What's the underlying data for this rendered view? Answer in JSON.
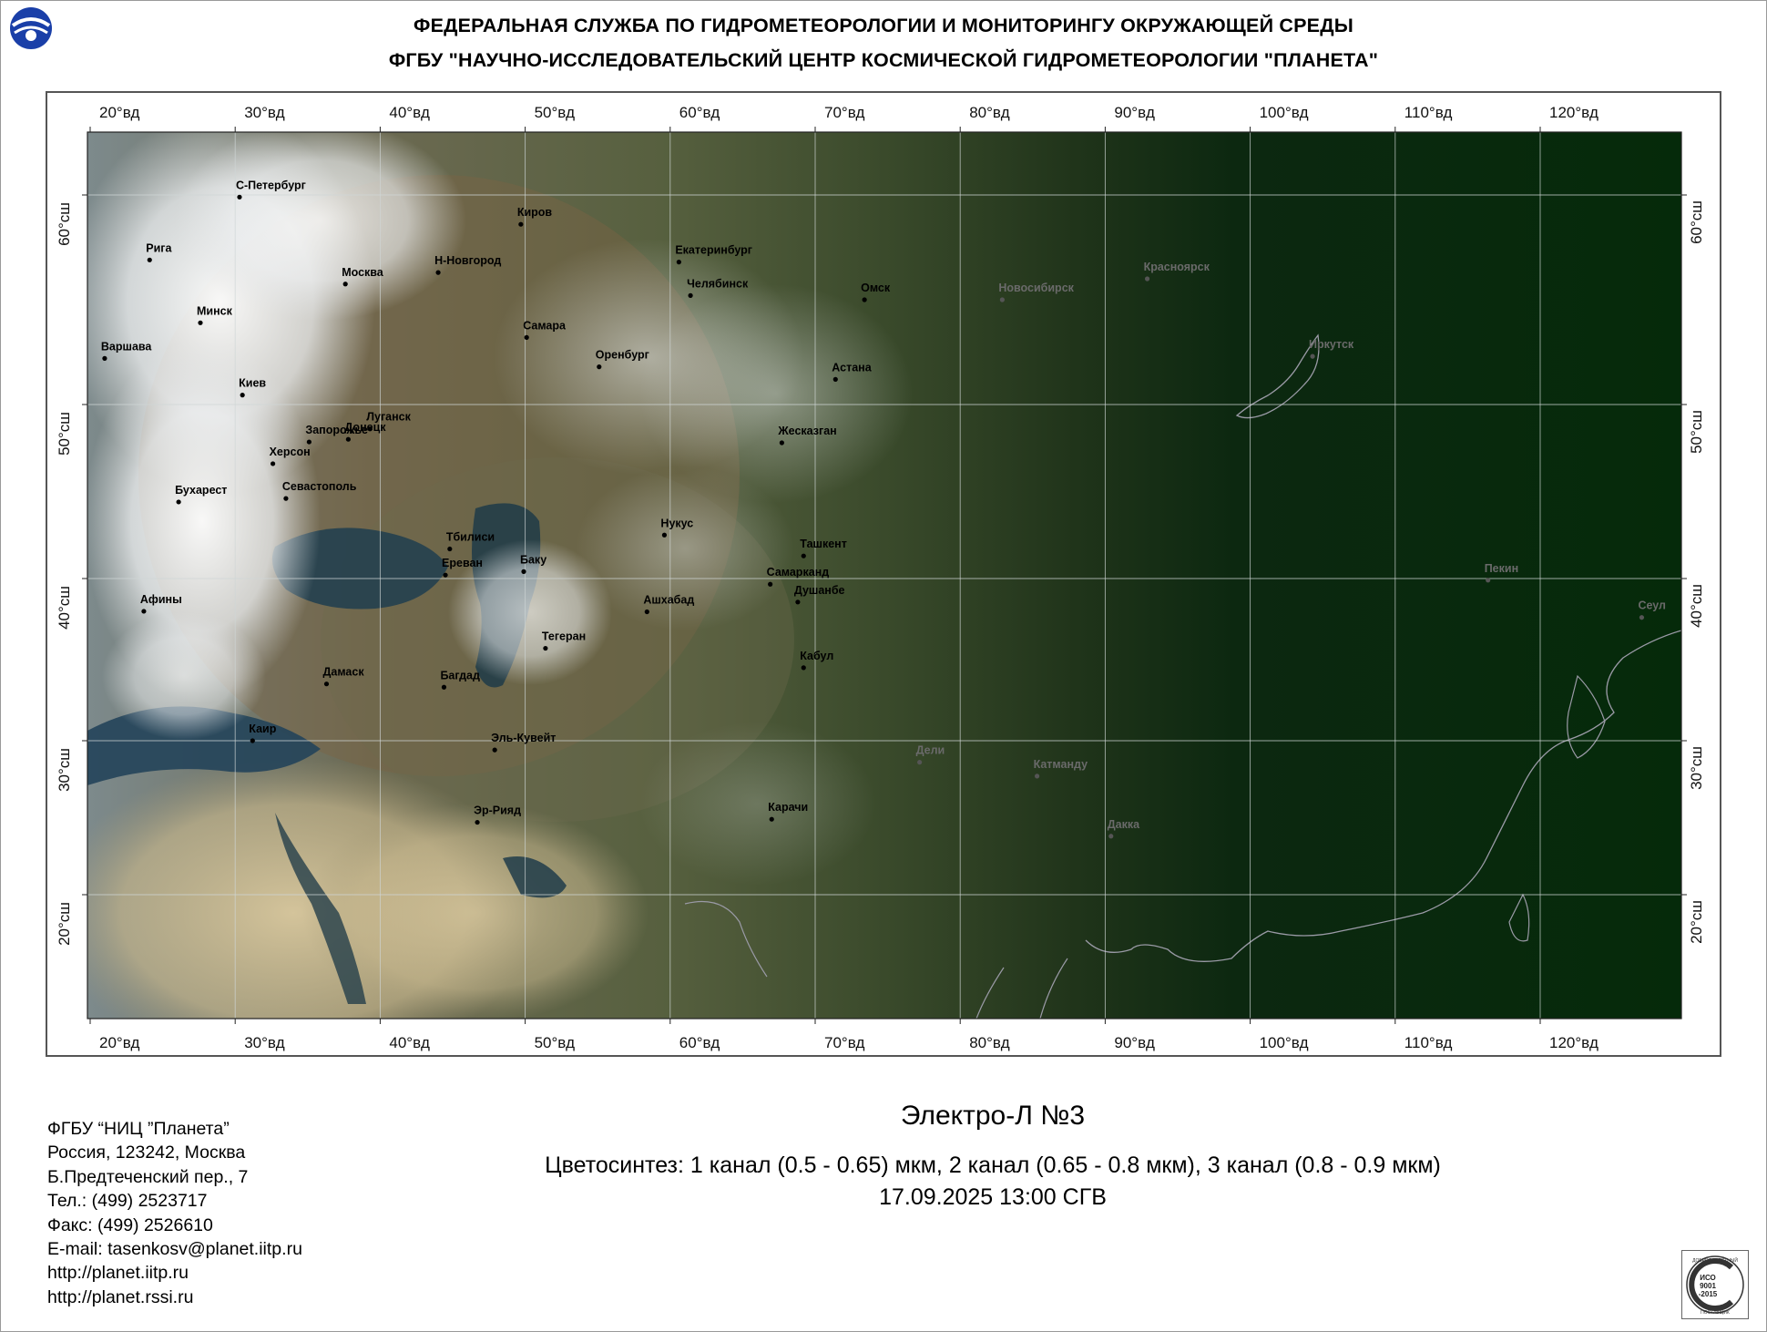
{
  "header": {
    "line1": "ФЕДЕРАЛЬНАЯ СЛУЖБА ПО ГИДРОМЕТЕОРОЛОГИИ И МОНИТОРИНГУ ОКРУЖАЮЩЕЙ СРЕДЫ",
    "line2": "ФГБУ \"НАУЧНО-ИССЛЕДОВАТЕЛЬСКИЙ ЦЕНТР КОСМИЧЕСКОЙ ГИДРОМЕТЕОРОЛОГИИ \"ПЛАНЕТА\""
  },
  "map": {
    "longitudes": [
      "20°вд",
      "30°вд",
      "40°вд",
      "50°вд",
      "60°вд",
      "70°вд",
      "80°вд",
      "90°вд",
      "100°вд",
      "110°вд",
      "120°вд"
    ],
    "latitudes": [
      "60°сш",
      "50°сш",
      "40°сш",
      "30°сш",
      "20°сш"
    ],
    "cities": [
      {
        "name": "С-Петербург",
        "lon": 30.3,
        "lat": 59.9
      },
      {
        "name": "Киров",
        "lon": 49.7,
        "lat": 58.6
      },
      {
        "name": "Рига",
        "lon": 24.1,
        "lat": 56.9
      },
      {
        "name": "Москва",
        "lon": 37.6,
        "lat": 55.75
      },
      {
        "name": "Н-Новгород",
        "lon": 44.0,
        "lat": 56.3
      },
      {
        "name": "Екатеринбург",
        "lon": 60.6,
        "lat": 56.8
      },
      {
        "name": "Челябинск",
        "lon": 61.4,
        "lat": 55.2
      },
      {
        "name": "Омск",
        "lon": 73.4,
        "lat": 55.0
      },
      {
        "name": "Новосибирск",
        "lon": 82.9,
        "lat": 55.0
      },
      {
        "name": "Красноярск",
        "lon": 92.9,
        "lat": 56.0
      },
      {
        "name": "Минск",
        "lon": 27.6,
        "lat": 53.9
      },
      {
        "name": "Варшава",
        "lon": 21.0,
        "lat": 52.2
      },
      {
        "name": "Самара",
        "lon": 50.1,
        "lat": 53.2
      },
      {
        "name": "Иркутск",
        "lon": 104.3,
        "lat": 52.3
      },
      {
        "name": "Оренбург",
        "lon": 55.1,
        "lat": 51.8
      },
      {
        "name": "Астана",
        "lon": 71.4,
        "lat": 51.2
      },
      {
        "name": "Киев",
        "lon": 30.5,
        "lat": 50.45
      },
      {
        "name": "Луганск",
        "lon": 39.3,
        "lat": 48.6
      },
      {
        "name": "Запорожье",
        "lon": 35.1,
        "lat": 47.85
      },
      {
        "name": "Донецк",
        "lon": 37.8,
        "lat": 48.0
      },
      {
        "name": "Жесказган",
        "lon": 67.7,
        "lat": 47.8
      },
      {
        "name": "Херсон",
        "lon": 32.6,
        "lat": 46.6
      },
      {
        "name": "Бухарест",
        "lon": 26.1,
        "lat": 44.4
      },
      {
        "name": "Севастополь",
        "lon": 33.5,
        "lat": 44.6
      },
      {
        "name": "Тбилиси",
        "lon": 44.8,
        "lat": 41.7
      },
      {
        "name": "Нукус",
        "lon": 59.6,
        "lat": 42.5
      },
      {
        "name": "Ташкент",
        "lon": 69.2,
        "lat": 41.3
      },
      {
        "name": "Ереван",
        "lon": 44.5,
        "lat": 40.2
      },
      {
        "name": "Баку",
        "lon": 49.9,
        "lat": 40.4
      },
      {
        "name": "Самарканд",
        "lon": 66.9,
        "lat": 39.65
      },
      {
        "name": "Душанбе",
        "lon": 68.8,
        "lat": 38.55
      },
      {
        "name": "Ашхабад",
        "lon": 58.4,
        "lat": 37.95
      },
      {
        "name": "Пекин",
        "lon": 116.4,
        "lat": 39.9
      },
      {
        "name": "Сеул",
        "lon": 127.0,
        "lat": 37.6
      },
      {
        "name": "Афины",
        "lon": 23.7,
        "lat": 37.98
      },
      {
        "name": "Тегеран",
        "lon": 51.4,
        "lat": 35.7
      },
      {
        "name": "Кабул",
        "lon": 69.2,
        "lat": 34.5
      },
      {
        "name": "Дамаск",
        "lon": 36.3,
        "lat": 33.5
      },
      {
        "name": "Багдад",
        "lon": 44.4,
        "lat": 33.3
      },
      {
        "name": "Каир",
        "lon": 31.2,
        "lat": 30.0
      },
      {
        "name": "Дели",
        "lon": 77.2,
        "lat": 28.6
      },
      {
        "name": "Катманду",
        "lon": 85.3,
        "lat": 27.7
      },
      {
        "name": "Эль-Кувейт",
        "lon": 47.9,
        "lat": 29.4
      },
      {
        "name": "Карачи",
        "lon": 67.0,
        "lat": 24.9
      },
      {
        "name": "Дакка",
        "lon": 90.4,
        "lat": 23.8
      },
      {
        "name": "Эр-Рияд",
        "lon": 46.7,
        "lat": 24.7
      }
    ]
  },
  "footer": {
    "org": "ФГБУ “НИЦ ”Планета”",
    "country": "Россия, 123242, Москва",
    "street": "Б.Предтеченский пер., 7",
    "phone": "Тел.: (499) 2523717",
    "fax": "Факс: (499) 2526610",
    "email": "E-mail: tasenkosv@planet.iitp.ru",
    "url1": "http://planet.iitp.ru",
    "url2": "http://planet.rssi.ru"
  },
  "satellite": {
    "title": "Электро-Л №3",
    "bands": "Цветосинтез: 1 канал (0.5 - 0.65) мкм, 2 канал (0.65 - 0.8 мкм), 3 канал (0.8 - 0.9 мкм)",
    "datetime": "17.09.2025  13:00 СГВ"
  },
  "iso_badge": {
    "top": "ДОБРОСОВЕСТНЫЙ",
    "mid1": "ИСО",
    "mid2": "9001",
    "mid3": "-2015",
    "bottom": "ПОСТАВЩИК"
  }
}
